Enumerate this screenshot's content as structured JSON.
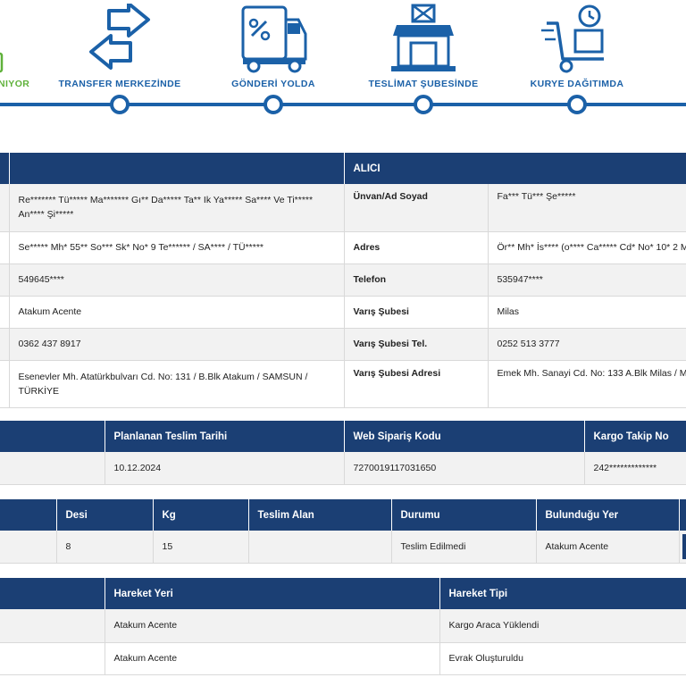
{
  "tracker": {
    "steps": [
      {
        "label": "NIYOR",
        "icon": "box-icon"
      },
      {
        "label": "TRANSFER MERKEZİNDE",
        "icon": "transfer-arrows-icon"
      },
      {
        "label": "GÖNDERİ YOLDA",
        "icon": "truck-icon"
      },
      {
        "label": "TESLİMAT ŞUBESİNDE",
        "icon": "store-icon"
      },
      {
        "label": "KURYE DAĞITIMDA",
        "icon": "hand-truck-icon"
      }
    ],
    "accent": "#1b61a8",
    "done_color": "#5fb13a"
  },
  "parties": {
    "receiver_header": "ALICI",
    "rows": [
      {
        "sender_value": "Re******* Tü***** Ma******* Gı** Da***** Ta** Ik Ya***** Sa**** Ve Ti***** An**** Şi*****",
        "label": "Ünvan/Ad Soyad",
        "receiver_value": "Fa*** Tü*** Şe*****"
      },
      {
        "sender_value": "Se***** Mh* 55** So*** Sk* No* 9 Te****** / SA**** / TÜ*****",
        "label": "Adres",
        "receiver_value": "Ör** Mh* İs**** (o**** Ca***** Cd* No* 10* 2 M"
      },
      {
        "sender_value": "549645****",
        "label": "Telefon",
        "receiver_value": "535947****"
      },
      {
        "sender_value": "Atakum Acente",
        "label": "Varış Şubesi",
        "receiver_value": "Milas"
      },
      {
        "sender_value": "0362 437 8917",
        "label": "Varış Şubesi Tel.",
        "receiver_value": "0252 513 3777"
      },
      {
        "sender_value": "Esenevler Mh. Atatürkbulvarı Cd. No: 131 / B.Blk Atakum / SAMSUN / TÜRKİYE",
        "label": "Varış Şubesi Adresi",
        "receiver_value": "Emek Mh. Sanayi Cd. No: 133 A.Blk Milas / M"
      }
    ]
  },
  "shipment": {
    "headers": [
      "Planlanan Teslim Tarihi",
      "Web Sipariş Kodu",
      "Kargo Takip No"
    ],
    "values": [
      "10.12.2024",
      "7270019117031650",
      "242*************"
    ]
  },
  "package": {
    "headers": [
      "Desi",
      "Kg",
      "Teslim Alan",
      "Durumu",
      "Bulunduğu Yer"
    ],
    "values": [
      "8",
      "15",
      "",
      "Teslim Edilmedi",
      "Atakum Acente"
    ]
  },
  "movements": {
    "headers": [
      "Hareket Yeri",
      "Hareket Tipi"
    ],
    "rows": [
      {
        "place": "Atakum Acente",
        "type": "Kargo Araca Yüklendi"
      },
      {
        "place": "Atakum Acente",
        "type": "Evrak Oluşturuldu"
      }
    ]
  }
}
